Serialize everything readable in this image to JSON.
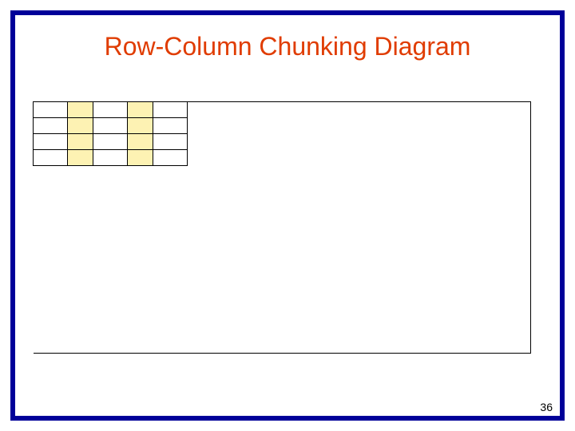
{
  "slide": {
    "title": "Row-Column Chunking Diagram",
    "page_number": "36"
  },
  "diagram": {
    "rows": 4,
    "columns": 5,
    "highlighted_columns": [
      2,
      4
    ]
  },
  "colors": {
    "border": "#000099",
    "title": "#e03c00",
    "highlight": "#fdf2b3"
  }
}
